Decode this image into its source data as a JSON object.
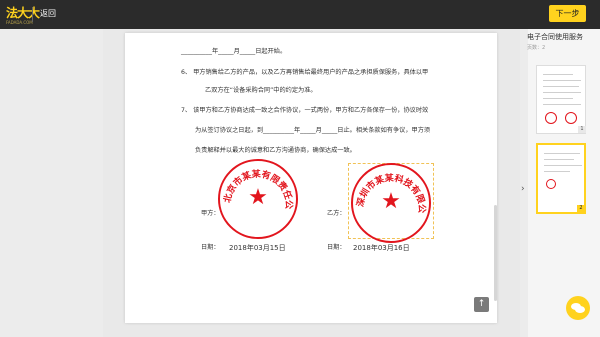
{
  "header": {
    "logo": "法大大",
    "logo_sub": "FADADA.COM",
    "back_label": "返回",
    "next_label": "下一步"
  },
  "document": {
    "lines": {
      "l1": "__________年_____月_____日起开始。",
      "l2a": "6、 甲方销售给乙方的产品，以及乙方再销售给最终用户的产品之承担质保服务，具体以甲",
      "l2b": "乙双方在“设备采购合同”中的约定为准。",
      "l3a": "7、 该甲方和乙方协商达成一致之合作协议，一式两份，甲方和乙方各保存一份，协议时效",
      "l3b": "为从签订协议之日起，到__________年_____月_____日止。相关条款如有争议，甲方须",
      "l3c": "负责解释并以最大的诚意和乙方沟通协商，确保达成一致。"
    },
    "party_a_label": "甲方：",
    "party_b_label": "乙方：",
    "date_a_label": "日期：",
    "date_a_value": "2018年03月15日",
    "date_b_label": "日期：",
    "date_b_value": "2018年03月16日",
    "stamp_a_text": "北京市某某有限责任公司",
    "stamp_b_text": "深圳市某某科技有限公司",
    "stamp_color": "#e2151d"
  },
  "sidebar": {
    "title": "电子合同使用服务",
    "subtitle": "页数：2",
    "pages": [
      "1",
      "2"
    ],
    "active_page": "2"
  },
  "icons": {
    "scroll_top": "arrow-up-icon",
    "next_page": "chevron-right-icon",
    "chat": "chat-bubble-icon"
  },
  "colors": {
    "accent": "#ffd21e",
    "topbar": "#2b2b2b"
  }
}
